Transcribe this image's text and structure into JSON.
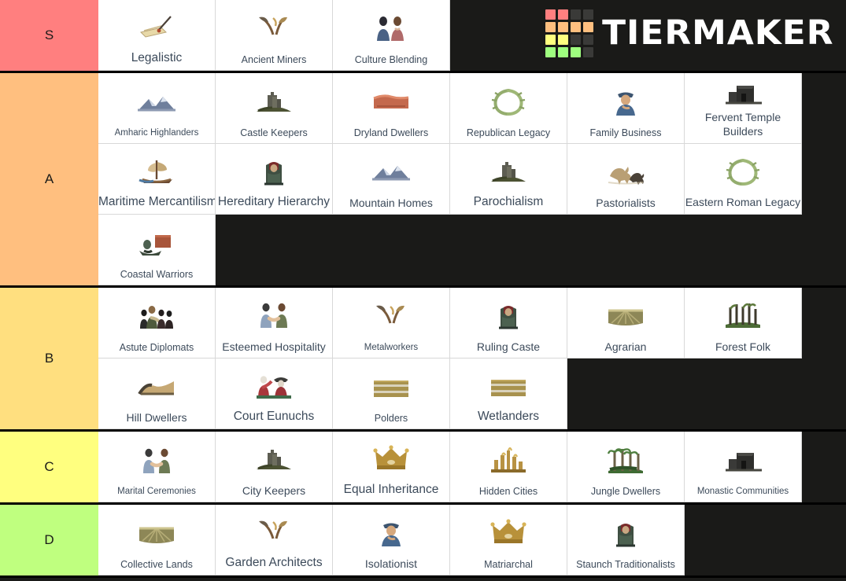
{
  "brand": {
    "name": "TIERMAKER",
    "logo_colors": [
      "#ff7f7f",
      "#ff7f7f",
      "#3a3a38",
      "#3a3a38",
      "#ffbf7f",
      "#ffbf7f",
      "#ffbf7f",
      "#ffbf7f",
      "#ffff7f",
      "#ffff7f",
      "#3a3a38",
      "#3a3a38",
      "#9fff7f",
      "#9fff7f",
      "#9fff7f",
      "#3a3a38"
    ]
  },
  "background": "#1a1a18",
  "tiers": [
    {
      "label": "S",
      "color": "#ff7f7f",
      "items": [
        {
          "name": "Legalistic",
          "icon": "scroll-quill-icon",
          "size": "s14"
        },
        {
          "name": "Ancient Miners",
          "icon": "pickaxes-icon",
          "size": "s12"
        },
        {
          "name": "Culture Blending",
          "icon": "two-people-icon",
          "size": "s12"
        }
      ]
    },
    {
      "label": "A",
      "color": "#ffbf7f",
      "items": [
        {
          "name": "Amharic Highlanders",
          "icon": "mountain-range-icon",
          "size": "s11"
        },
        {
          "name": "Castle Keepers",
          "icon": "castle-hill-icon",
          "size": "s12"
        },
        {
          "name": "Dryland Dwellers",
          "icon": "desert-mesa-icon",
          "size": "s12"
        },
        {
          "name": "Republican Legacy",
          "icon": "laurel-wreath-icon",
          "size": "s12"
        },
        {
          "name": "Family Business",
          "icon": "merchant-man-icon",
          "size": "s12"
        },
        {
          "name": "Fervent Temple Builders",
          "icon": "stone-temple-icon",
          "size": "s13",
          "wrap": true
        },
        {
          "name": "Maritime Mercantilism",
          "icon": "sailing-ship-icon",
          "size": "s14"
        },
        {
          "name": "Hereditary Hierarchy",
          "icon": "throne-icon",
          "size": "s14"
        },
        {
          "name": "Mountain Homes",
          "icon": "mountain-range-icon",
          "size": "s13"
        },
        {
          "name": "Parochialism",
          "icon": "castle-hill-icon",
          "size": "s14"
        },
        {
          "name": "Pastorialists",
          "icon": "horse-wolf-icon",
          "size": "s13"
        },
        {
          "name": "Eastern Roman Legacy",
          "icon": "laurel-wreath-icon",
          "size": "s13",
          "wrap": true
        },
        {
          "name": "Coastal Warriors",
          "icon": "longship-raid-icon",
          "size": "s12"
        }
      ]
    },
    {
      "label": "B",
      "color": "#ffdf7f",
      "items": [
        {
          "name": "Astute Diplomats",
          "icon": "diplomats-group-icon",
          "size": "s12"
        },
        {
          "name": "Esteemed Hospitality",
          "icon": "handshake-icon",
          "size": "s13"
        },
        {
          "name": "Metalworkers",
          "icon": "pickaxes-icon",
          "size": "s11"
        },
        {
          "name": "Ruling Caste",
          "icon": "throne-icon",
          "size": "s13"
        },
        {
          "name": "Agrarian",
          "icon": "farm-field-icon",
          "size": "s13"
        },
        {
          "name": "Forest Folk",
          "icon": "forest-icon",
          "size": "s13"
        },
        {
          "name": "Hill Dwellers",
          "icon": "hills-icon",
          "size": "s13"
        },
        {
          "name": "Court Eunuchs",
          "icon": "court-eunuchs-icon",
          "size": "s14"
        },
        {
          "name": "Polders",
          "icon": "polder-fields-icon",
          "size": "s12"
        },
        {
          "name": "Wetlanders",
          "icon": "polder-fields-icon",
          "size": "s14"
        }
      ]
    },
    {
      "label": "C",
      "color": "#ffff7f",
      "items": [
        {
          "name": "Marital Ceremonies",
          "icon": "handshake-icon",
          "size": "s11"
        },
        {
          "name": "City Keepers",
          "icon": "castle-hill-icon",
          "size": "s13"
        },
        {
          "name": "Equal Inheritance",
          "icon": "crown-icon",
          "size": "s14"
        },
        {
          "name": "Hidden Cities",
          "icon": "golden-city-icon",
          "size": "s12"
        },
        {
          "name": "Jungle Dwellers",
          "icon": "jungle-icon",
          "size": "s12"
        },
        {
          "name": "Monastic Communities",
          "icon": "stone-temple-icon",
          "size": "s11"
        }
      ]
    },
    {
      "label": "D",
      "color": "#bfff7f",
      "items": [
        {
          "name": "Collective Lands",
          "icon": "farm-field-icon",
          "size": "s12"
        },
        {
          "name": "Garden Architects",
          "icon": "pickaxes-icon",
          "size": "s14"
        },
        {
          "name": "Isolationist",
          "icon": "merchant-man-icon",
          "size": "s13"
        },
        {
          "name": "Matriarchal",
          "icon": "crown-icon",
          "size": "s12"
        },
        {
          "name": "Staunch Traditionalists",
          "icon": "throne-icon",
          "size": "s12"
        }
      ]
    }
  ]
}
